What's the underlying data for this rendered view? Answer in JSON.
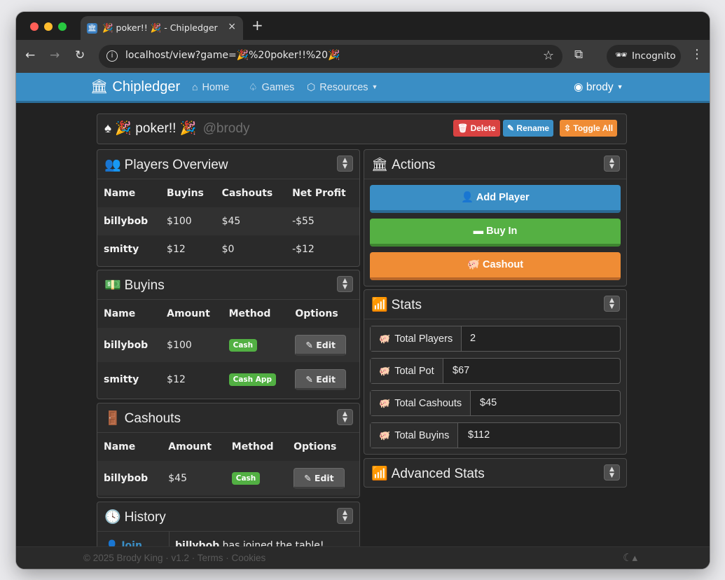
{
  "browser": {
    "tab_title": "🎉 poker!! 🎉 - Chipledger",
    "close": "×",
    "new_tab": "+",
    "url": "localhost/view?game=🎉%20poker!!%20🎉",
    "incognito_label": "Incognito"
  },
  "navbar": {
    "brand": "Chipledger",
    "links": [
      {
        "label": "Home",
        "icon": "house-icon"
      },
      {
        "label": "Games",
        "icon": "spade-icon"
      },
      {
        "label": "Resources",
        "icon": "cube-icon"
      }
    ],
    "user": "brody"
  },
  "game": {
    "title": "🎉 poker!! 🎉",
    "owner": "@brody",
    "delete_label": "Delete",
    "rename_label": "Rename",
    "toggle_label": "Toggle All"
  },
  "players_overview": {
    "title": "Players Overview",
    "headers": [
      "Name",
      "Buyins",
      "Cashouts",
      "Net Profit"
    ],
    "rows": [
      [
        "billybob",
        "$100",
        "$45",
        "-$55"
      ],
      [
        "smitty",
        "$12",
        "$0",
        "-$12"
      ]
    ]
  },
  "buyins": {
    "title": "Buyins",
    "headers": [
      "Name",
      "Amount",
      "Method",
      "Options"
    ],
    "rows": [
      {
        "name": "billybob",
        "amount": "$100",
        "method": "Cash",
        "option": "Edit"
      },
      {
        "name": "smitty",
        "amount": "$12",
        "method": "Cash App",
        "option": "Edit"
      }
    ]
  },
  "cashouts": {
    "title": "Cashouts",
    "headers": [
      "Name",
      "Amount",
      "Method",
      "Options"
    ],
    "rows": [
      {
        "name": "billybob",
        "amount": "$45",
        "method": "Cash",
        "option": "Edit"
      }
    ]
  },
  "history": {
    "title": "History",
    "rows": [
      {
        "type": "Join",
        "player": "billybob",
        "text": " has joined the table!"
      }
    ]
  },
  "actions": {
    "title": "Actions",
    "add_player": "Add Player",
    "buy_in": "Buy In",
    "cashout": "Cashout"
  },
  "stats": {
    "title": "Stats",
    "items": [
      {
        "label": "Total Players",
        "value": "2"
      },
      {
        "label": "Total Pot",
        "value": "$67"
      },
      {
        "label": "Total Cashouts",
        "value": "$45"
      },
      {
        "label": "Total Buyins",
        "value": "$112"
      }
    ]
  },
  "advanced_stats": {
    "title": "Advanced Stats"
  },
  "footer": {
    "text": "© 2025 Brody King · v1.2 · Terms · Cookies"
  },
  "colors": {
    "primary": "#3a8ec5",
    "success": "#55b043",
    "warning": "#ef8c35",
    "danger": "#d94241",
    "background": "#222222"
  }
}
